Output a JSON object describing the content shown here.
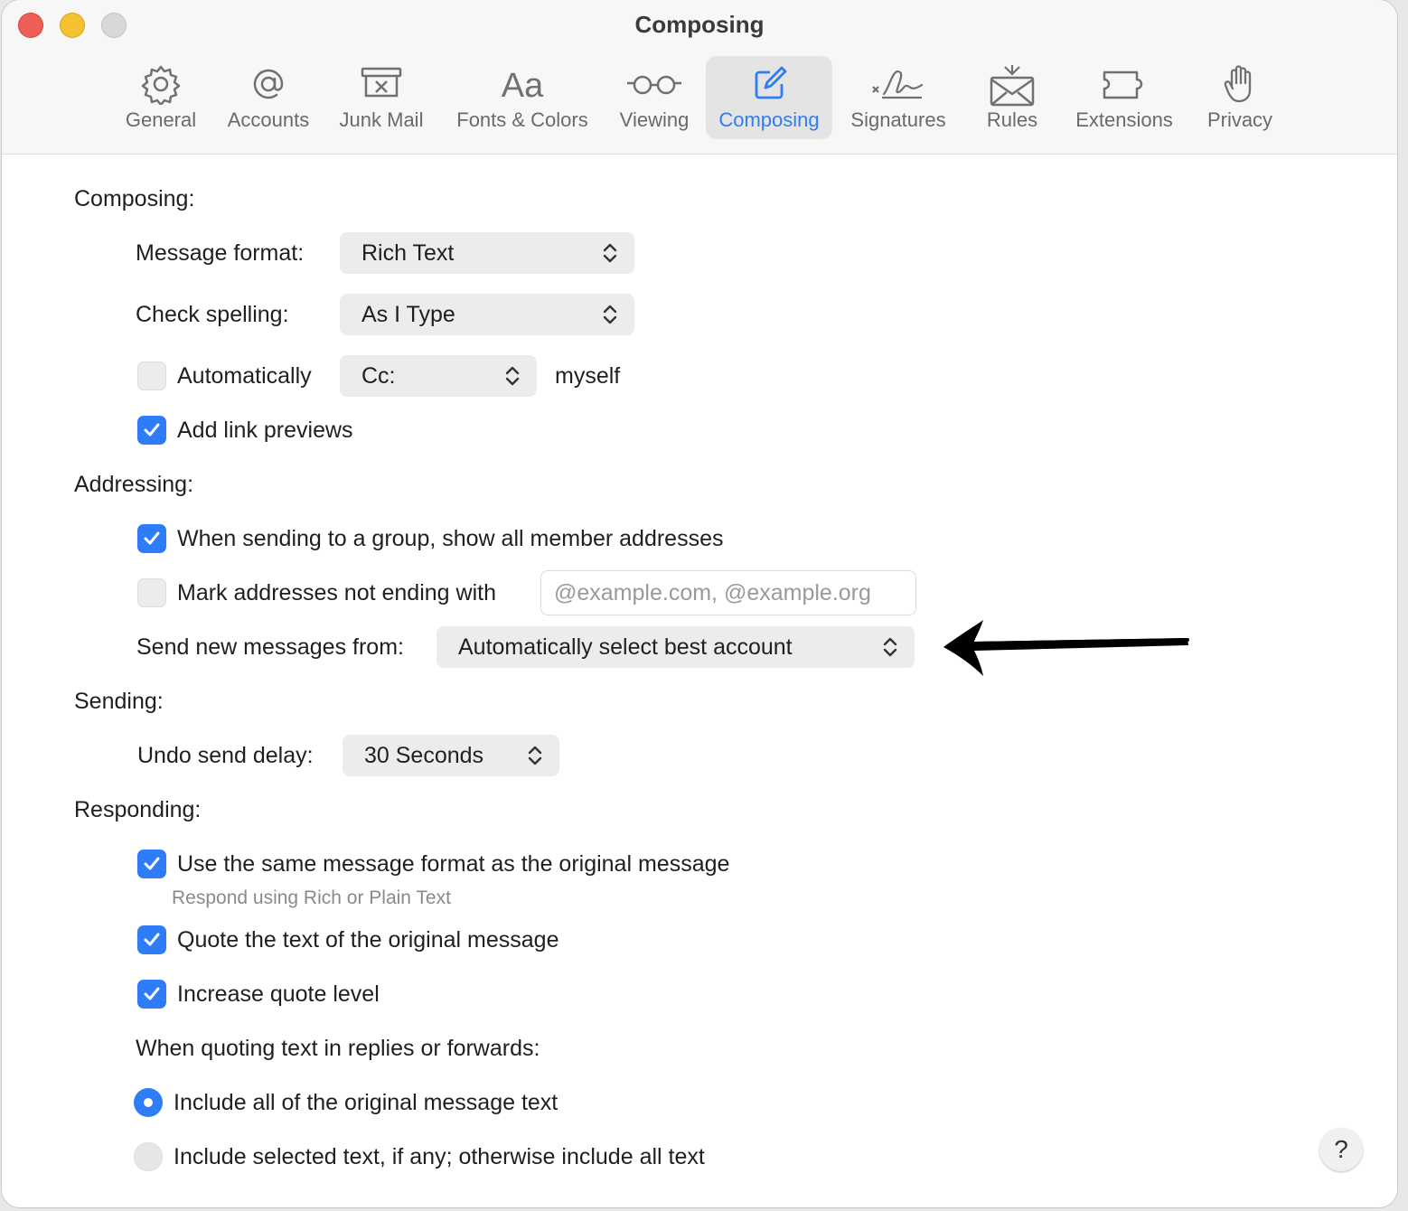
{
  "window": {
    "title": "Composing"
  },
  "toolbar": {
    "tabs": [
      {
        "label": "General",
        "icon": "gear-icon"
      },
      {
        "label": "Accounts",
        "icon": "at-icon"
      },
      {
        "label": "Junk Mail",
        "icon": "junk-mail-icon"
      },
      {
        "label": "Fonts & Colors",
        "icon": "fonts-icon"
      },
      {
        "label": "Viewing",
        "icon": "glasses-icon"
      },
      {
        "label": "Composing",
        "icon": "compose-icon",
        "selected": true
      },
      {
        "label": "Signatures",
        "icon": "signature-icon"
      },
      {
        "label": "Rules",
        "icon": "rules-icon"
      },
      {
        "label": "Extensions",
        "icon": "puzzle-icon"
      },
      {
        "label": "Privacy",
        "icon": "hand-icon"
      }
    ]
  },
  "composing": {
    "heading": "Composing:",
    "message_format_label": "Message format:",
    "message_format_value": "Rich Text",
    "check_spelling_label": "Check spelling:",
    "check_spelling_value": "As I Type",
    "automatically_label": "Automatically",
    "automatically_checked": false,
    "cc_value": "Cc:",
    "myself_label": "myself",
    "link_previews_label": "Add link previews",
    "link_previews_checked": true
  },
  "addressing": {
    "heading": "Addressing:",
    "group_label": "When sending to a group, show all member addresses",
    "group_checked": true,
    "mark_label": "Mark addresses not ending with",
    "mark_checked": false,
    "mark_placeholder": "@example.com, @example.org",
    "send_from_label": "Send new messages from:",
    "send_from_value": "Automatically select best account"
  },
  "sending": {
    "heading": "Sending:",
    "undo_label": "Undo send delay:",
    "undo_value": "30 Seconds"
  },
  "responding": {
    "heading": "Responding:",
    "same_format_label": "Use the same message format as the original message",
    "same_format_checked": true,
    "same_format_sub": "Respond using Rich or Plain Text",
    "quote_label": "Quote the text of the original message",
    "quote_checked": true,
    "increase_label": "Increase quote level",
    "increase_checked": true,
    "quoting_heading": "When quoting text in replies or forwards:",
    "include_all_label": "Include all of the original message text",
    "include_all_selected": true,
    "include_selected_label": "Include selected text, if any; otherwise include all text",
    "include_selected_selected": false
  },
  "help": {
    "label": "?"
  },
  "colors": {
    "accent": "#2f7df6",
    "popup_bg": "#ececec",
    "annotation": "#000000"
  }
}
